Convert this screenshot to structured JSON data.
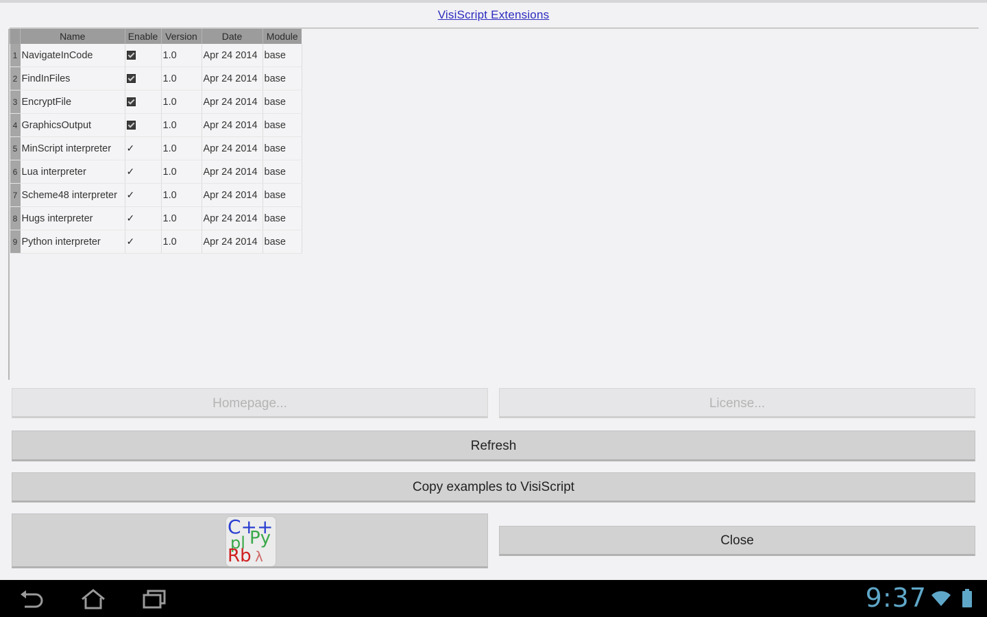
{
  "window": {
    "title": "VisiScript Extensions"
  },
  "table": {
    "headers": {
      "name": "Name",
      "enable": "Enable",
      "version": "Version",
      "date": "Date",
      "module": "Module"
    },
    "rows": [
      {
        "n": "1",
        "name": "NavigateInCode",
        "enabled": true,
        "style": "filled",
        "version": "1.0",
        "date": "Apr 24 2014",
        "module": "base"
      },
      {
        "n": "2",
        "name": "FindInFiles",
        "enabled": true,
        "style": "filled",
        "version": "1.0",
        "date": "Apr 24 2014",
        "module": "base"
      },
      {
        "n": "3",
        "name": "EncryptFile",
        "enabled": true,
        "style": "filled",
        "version": "1.0",
        "date": "Apr 24 2014",
        "module": "base"
      },
      {
        "n": "4",
        "name": "GraphicsOutput",
        "enabled": true,
        "style": "filled",
        "version": "1.0",
        "date": "Apr 24 2014",
        "module": "base"
      },
      {
        "n": "5",
        "name": "MinScript interpreter",
        "enabled": true,
        "style": "tick",
        "version": "1.0",
        "date": "Apr 24 2014",
        "module": "base"
      },
      {
        "n": "6",
        "name": "Lua interpreter",
        "enabled": true,
        "style": "tick",
        "version": "1.0",
        "date": "Apr 24 2014",
        "module": "base"
      },
      {
        "n": "7",
        "name": "Scheme48 interpreter",
        "enabled": true,
        "style": "tick",
        "version": "1.0",
        "date": "Apr 24 2014",
        "module": "base"
      },
      {
        "n": "8",
        "name": "Hugs interpreter",
        "enabled": true,
        "style": "tick",
        "version": "1.0",
        "date": "Apr 24 2014",
        "module": "base"
      },
      {
        "n": "9",
        "name": "Python interpreter",
        "enabled": true,
        "style": "tick",
        "version": "1.0",
        "date": "Apr 24 2014",
        "module": "base"
      }
    ]
  },
  "buttons": {
    "homepage": "Homepage...",
    "license": "License...",
    "refresh": "Refresh",
    "copy_examples": "Copy examples to VisiScript",
    "close": "Close"
  },
  "logo": {
    "line1": "C++",
    "pl": "pl",
    "py": "Py",
    "rb": "Rb",
    "lambda": "λ"
  },
  "status_bar": {
    "time": "9:37"
  },
  "colors": {
    "title_link": "#2b2bbf",
    "clock": "#5fa7c8",
    "logo_cpp": "#2b3fd0",
    "logo_py": "#3aa84a",
    "logo_rb": "#d02020"
  }
}
